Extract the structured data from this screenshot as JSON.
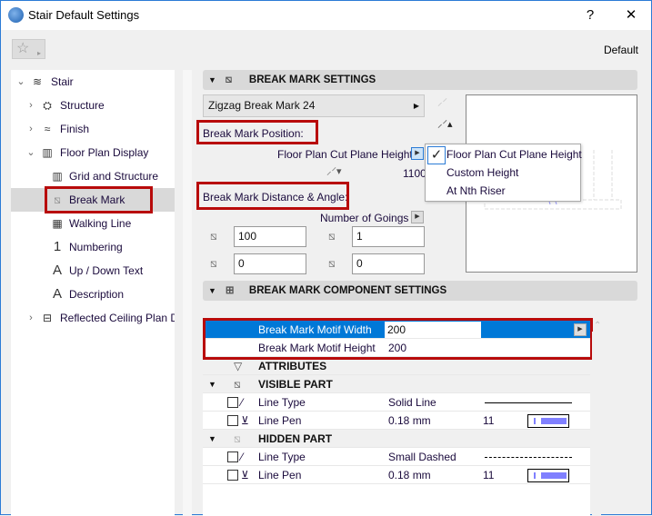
{
  "window": {
    "title": "Stair Default Settings",
    "help": "?",
    "close": "✕"
  },
  "favorites": {
    "icon": "star-icon",
    "arrow": "▸"
  },
  "preset": "Default",
  "tree": [
    {
      "label": "Stair",
      "level": 0,
      "expanded": true
    },
    {
      "label": "Structure",
      "level": 1,
      "expanded": false
    },
    {
      "label": "Finish",
      "level": 1,
      "expanded": false
    },
    {
      "label": "Floor Plan Display",
      "level": 1,
      "expanded": true
    },
    {
      "label": "Grid and Structure",
      "level": 2
    },
    {
      "label": "Break Mark",
      "level": 2,
      "selected": true
    },
    {
      "label": "Walking Line",
      "level": 2
    },
    {
      "label": "Numbering",
      "level": 2
    },
    {
      "label": "Up / Down Text",
      "level": 2
    },
    {
      "label": "Description",
      "level": 2
    },
    {
      "label": "Reflected Ceiling Plan Di",
      "level": 1,
      "expanded": false
    }
  ],
  "break_mark": {
    "header": "BREAK MARK SETTINGS",
    "type": "Zigzag Break Mark 24",
    "position_label": "Break Mark Position:",
    "position_value": "Floor Plan Cut Plane Height",
    "height_value": "1100",
    "distance_label": "Break Mark Distance & Angle:",
    "goings_label": "Number of Goings",
    "fields": {
      "distance": "100",
      "goings": "1",
      "offset": "0",
      "angle": "0"
    },
    "menu": [
      "Floor Plan Cut Plane Height",
      "Custom Height",
      "At Nth Riser"
    ],
    "menu_checked": 0
  },
  "component": {
    "header": "BREAK MARK COMPONENT SETTINGS",
    "rows": [
      {
        "label": "Break Mark Motif Width",
        "value": "200",
        "selected": true
      },
      {
        "label": "Break Mark Motif Height",
        "value": "200"
      }
    ],
    "attributes": "ATTRIBUTES",
    "groups": [
      {
        "title": "VISIBLE PART",
        "line_type_label": "Line Type",
        "line_type": "Solid Line",
        "pen_label": "Line Pen",
        "pen_width": "0.18 mm",
        "pen_number": "11"
      },
      {
        "title": "HIDDEN PART",
        "line_type_label": "Line Type",
        "line_type": "Small Dashed",
        "pen_label": "Line Pen",
        "pen_width": "0.18 mm",
        "pen_number": "11"
      }
    ]
  },
  "colors": {
    "selection": "#0078d7",
    "highlight_box": "#b80b0b",
    "pen_color": "#8080ff"
  }
}
